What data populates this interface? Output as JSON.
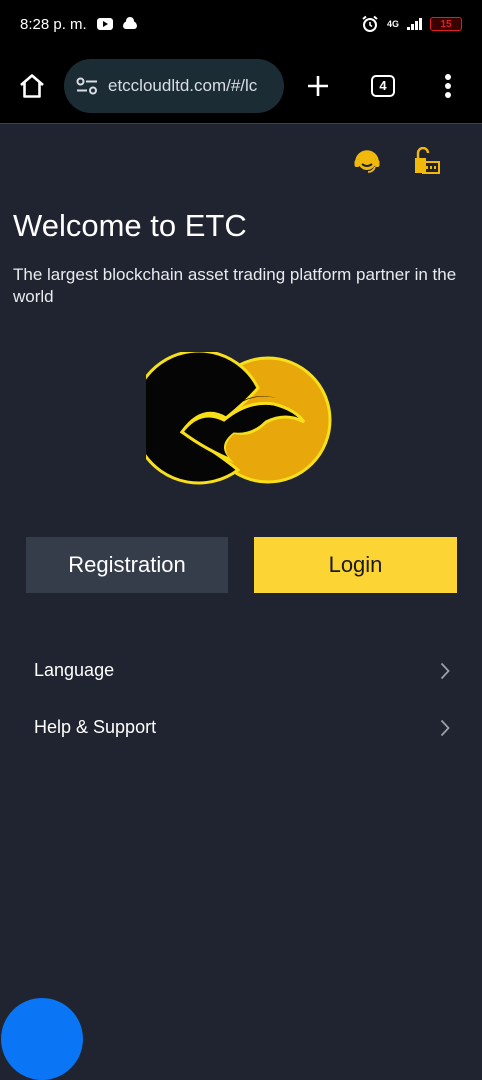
{
  "status_bar": {
    "time": "8:28 p. m.",
    "network": "4G",
    "battery": "15"
  },
  "browser": {
    "url": "etccloudltd.com/#/lc",
    "tab_count": "4"
  },
  "header": {
    "support_icon": "headset-icon",
    "lock_icon": "unlock-icon"
  },
  "main": {
    "title": "Welcome to ETC",
    "subtitle": "The largest blockchain asset trading platform partner in the world"
  },
  "buttons": {
    "registration": "Registration",
    "login": "Login"
  },
  "menu": {
    "items": [
      {
        "label": "Language"
      },
      {
        "label": "Help & Support"
      }
    ]
  },
  "colors": {
    "background": "#1f2430",
    "accent": "#fcd535",
    "secondary_button": "#363d4a",
    "float_button": "#0a75f5"
  }
}
